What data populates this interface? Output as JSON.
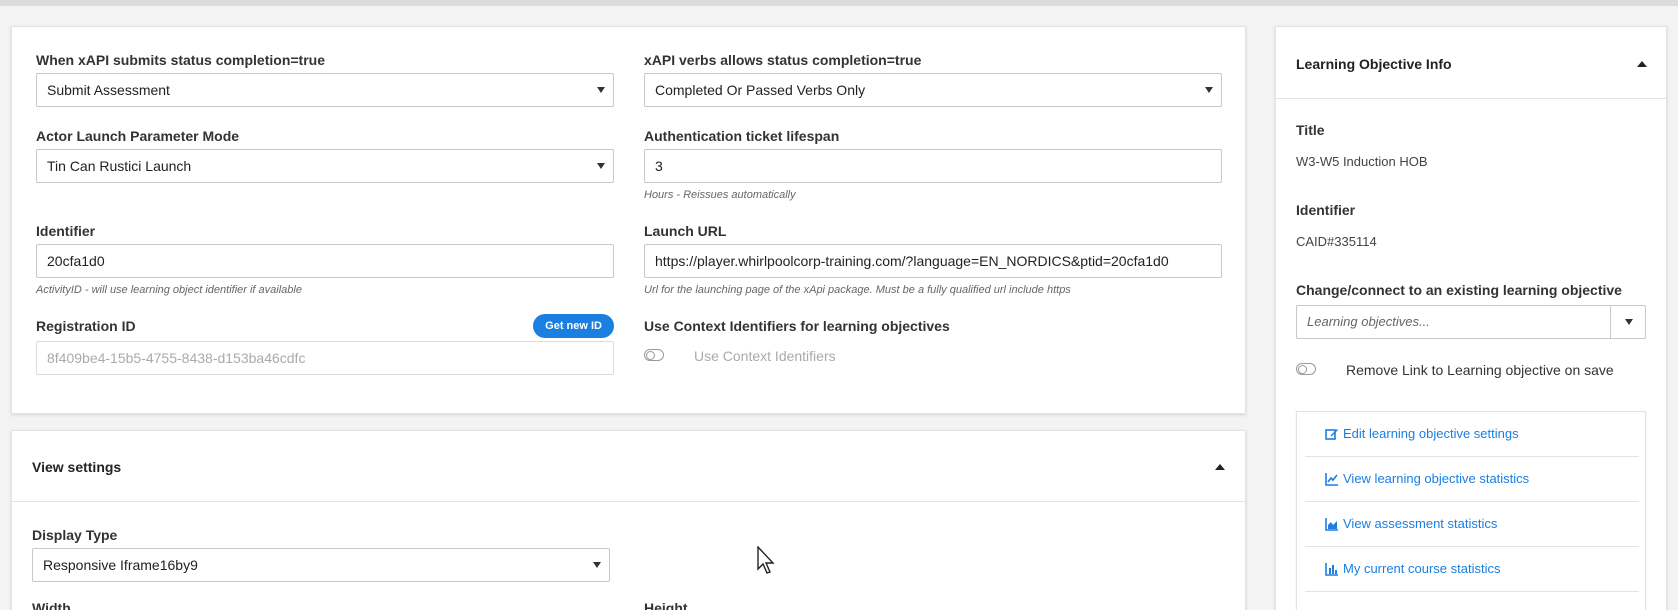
{
  "xapi": {
    "completion_label": "When xAPI submits status completion=true",
    "completion_value": "Submit Assessment",
    "verbs_label": "xAPI verbs allows status completion=true",
    "verbs_value": "Completed Or Passed Verbs Only",
    "actor_label": "Actor Launch Parameter Mode",
    "actor_value": "Tin Can Rustici Launch",
    "ticket_label": "Authentication ticket lifespan",
    "ticket_value": "3",
    "ticket_help": "Hours - Reissues automatically",
    "identifier_label": "Identifier",
    "identifier_value": "20cfa1d0",
    "identifier_help": "ActivityID - will use learning object identifier if available",
    "launch_label": "Launch URL",
    "launch_value": "https://player.whirlpoolcorp-training.com/?language=EN_NORDICS&ptid=20cfa1d0",
    "launch_help": "Url for the launching page of the xApi package. Must be a fully qualified url include https",
    "registration_label": "Registration ID",
    "registration_button": "Get new ID",
    "registration_value": "8f409be4-15b5-4755-8438-d153ba46cdfc",
    "context_label": "Use Context Identifiers for learning objectives",
    "context_toggle_label": "Use Context Identifiers"
  },
  "view": {
    "title": "View settings",
    "display_type_label": "Display Type",
    "display_type_value": "Responsive Iframe16by9",
    "width_label": "Width",
    "height_label": "Height"
  },
  "learning_objective": {
    "title": "Learning Objective Info",
    "title_label": "Title",
    "title_value": "W3-W5 Induction HOB",
    "identifier_label": "Identifier",
    "identifier_value": "CAID#335114",
    "change_label": "Change/connect to an existing learning objective",
    "select_placeholder": "Learning objectives...",
    "remove_link_label": "Remove Link to Learning objective on save",
    "links": [
      {
        "label": "Edit learning objective settings",
        "icon": "edit-icon"
      },
      {
        "label": "View learning objective statistics",
        "icon": "line-chart-icon"
      },
      {
        "label": "View assessment statistics",
        "icon": "area-chart-icon"
      },
      {
        "label": "My current course statistics",
        "icon": "bar-chart-icon"
      }
    ]
  },
  "colors": {
    "accent": "#1a7fe0",
    "background": "#f3f3f3"
  }
}
